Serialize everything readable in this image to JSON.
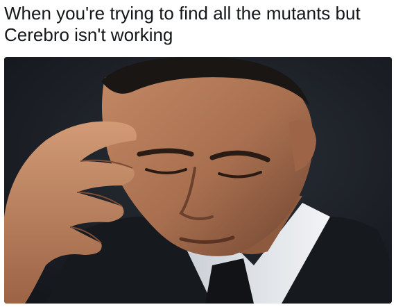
{
  "meme": {
    "caption_line1": "When you're trying to find all the mutants but",
    "caption_line2": "Cerebro isn't working",
    "photo_subject": "man-holding-forehead-looking-down"
  },
  "colors": {
    "background": "#ffffff",
    "text": "#14171a",
    "photo_background": "#1c2026",
    "skin": "#b77d5c",
    "suit": "#16191d",
    "shirt": "#dfe3e8"
  }
}
